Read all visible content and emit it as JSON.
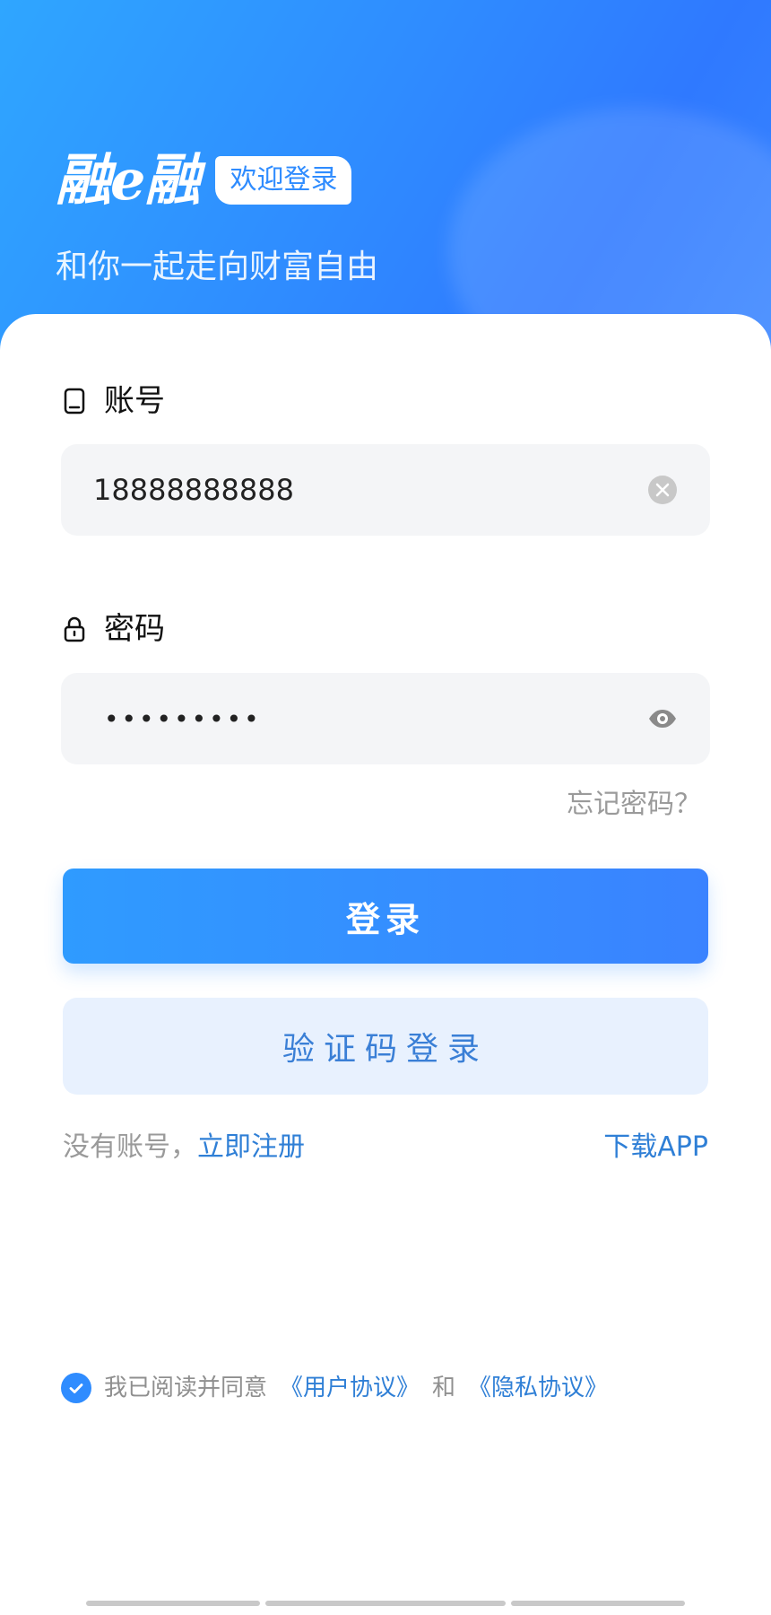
{
  "header": {
    "brand": "融e融",
    "welcome_badge": "欢迎登录",
    "tagline": "和你一起走向财富自由"
  },
  "form": {
    "account_label": "账号",
    "account_value": "18888888888",
    "password_label": "密码",
    "password_mask": "•••••••••",
    "forgot_password": "忘记密码？"
  },
  "actions": {
    "login_button": "登录",
    "sms_login_button": "验证码登录",
    "no_account_prefix": "没有账号，",
    "register_link": "立即注册",
    "download_link": "下载APP"
  },
  "agreement": {
    "prefix": "我已阅读并同意",
    "user_agreement": "《用户协议》",
    "and": "和",
    "privacy_agreement": "《隐私协议》"
  },
  "icons": {
    "phone": "phone-icon",
    "lock": "lock-icon",
    "clear": "clear-icon",
    "eye": "eye-icon",
    "check": "check-icon"
  },
  "colors": {
    "primary": "#2f8cff",
    "primary_light": "#e8f1fe",
    "link": "#2f7fd6",
    "muted_text": "#9a9a9a",
    "input_bg": "#f4f5f7"
  }
}
